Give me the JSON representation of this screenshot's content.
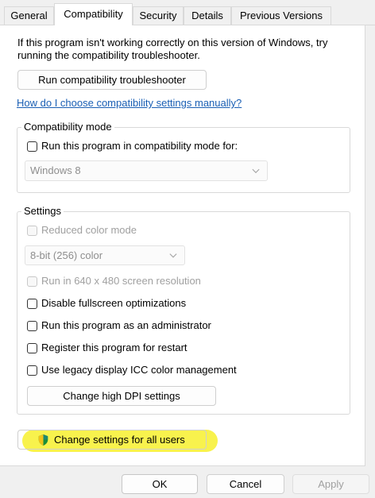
{
  "tabs": [
    "General",
    "Compatibility",
    "Security",
    "Details",
    "Previous Versions"
  ],
  "intro_text": "If this program isn't working correctly on this version of Windows, try running the compatibility troubleshooter.",
  "troubleshooter_button": "Run compatibility troubleshooter",
  "help_link": "How do I choose compatibility settings manually?",
  "compat_mode": {
    "legend": "Compatibility mode",
    "checkbox_label": "Run this program in compatibility mode for:",
    "os_select_value": "Windows 8"
  },
  "settings": {
    "legend": "Settings",
    "reduced_color_label": "Reduced color mode",
    "color_select_value": "8-bit (256) color",
    "resolution_label": "Run in 640 x 480 screen resolution",
    "disable_fullscreen_label": "Disable fullscreen optimizations",
    "run_as_admin_label": "Run this program as an administrator",
    "register_restart_label": "Register this program for restart",
    "legacy_icc_label": "Use legacy display ICC color management",
    "dpi_button": "Change high DPI settings"
  },
  "all_users_button": "Change settings for all users",
  "footer": {
    "ok": "OK",
    "cancel": "Cancel",
    "apply": "Apply"
  },
  "colors": {
    "link": "#1a5fb4",
    "highlight": "#f7f13a",
    "accent_border": "#0067c0"
  }
}
